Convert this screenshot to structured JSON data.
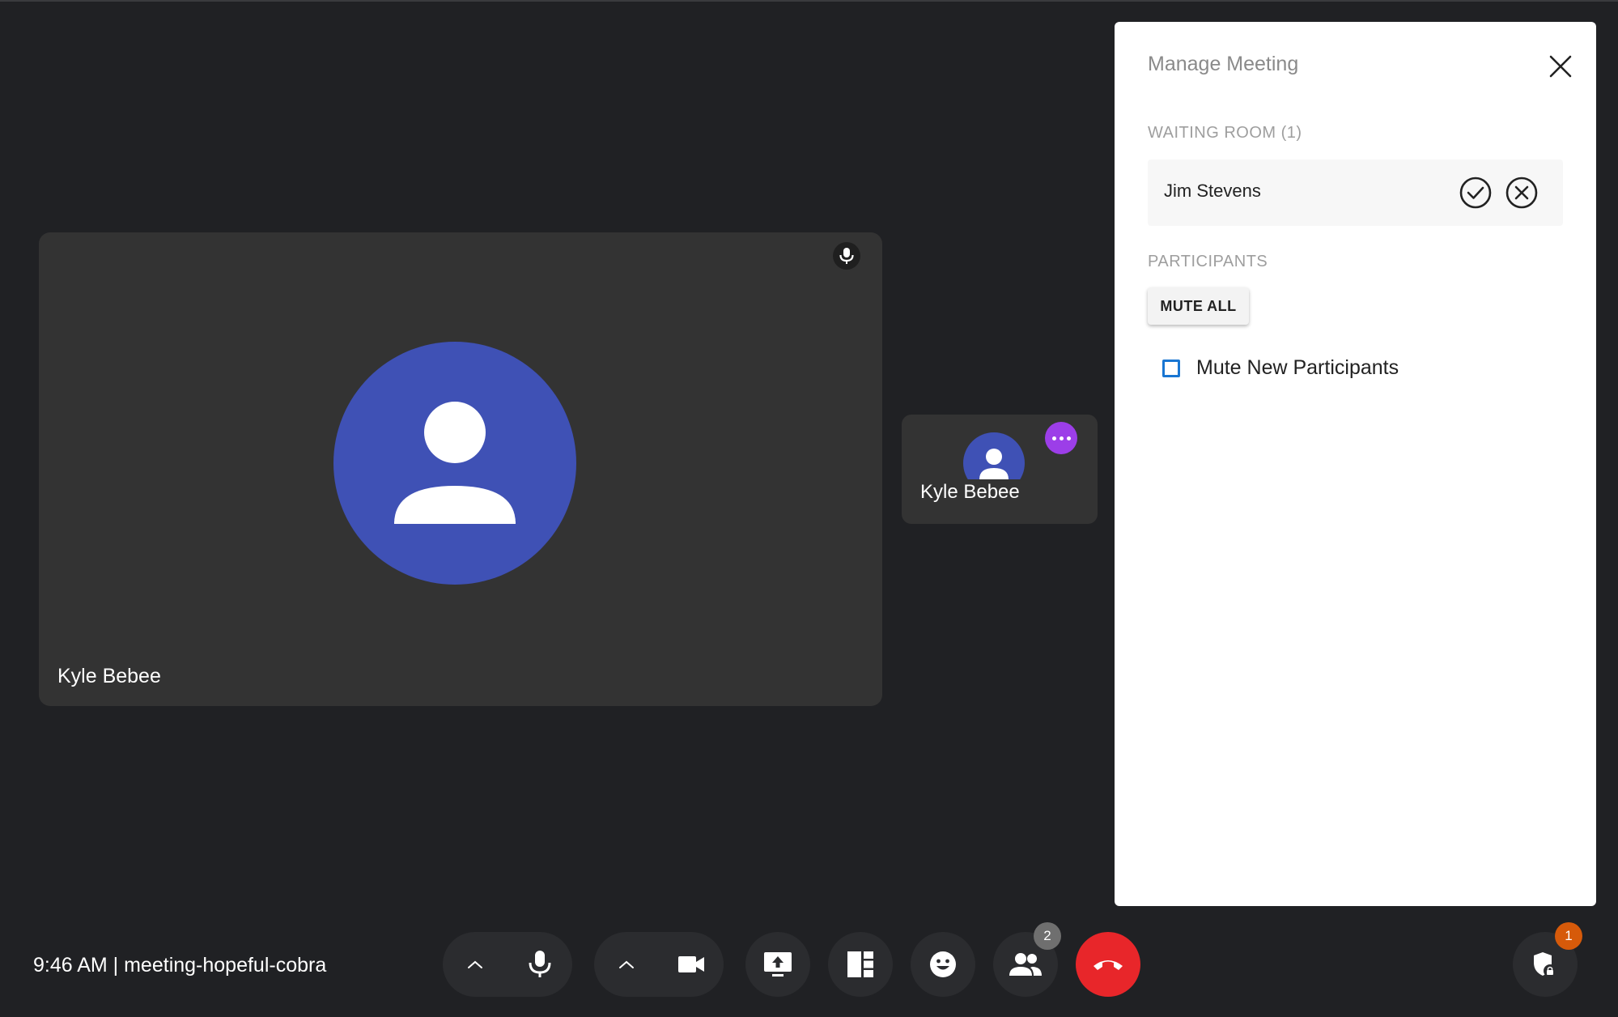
{
  "main_tile": {
    "participant_name": "Kyle Bebee",
    "mic_icon": "microphone-icon",
    "avatar_color": "#3f51b5"
  },
  "small_tile": {
    "participant_name": "Kyle Bebee",
    "menu_icon": "more-horizontal-icon",
    "menu_color": "#9c3ee8"
  },
  "manage_panel": {
    "title": "Manage Meeting",
    "close_icon": "close-icon",
    "waiting_room": {
      "label": "WAITING ROOM (1)",
      "people": [
        {
          "name": "Jim Stevens",
          "admit_icon": "check-circle-icon",
          "deny_icon": "x-circle-icon"
        }
      ]
    },
    "participants": {
      "label": "PARTICIPANTS",
      "mute_all_label": "MUTE ALL",
      "mute_new_label": "Mute New Participants",
      "mute_new_checked": false
    }
  },
  "bottom_bar": {
    "meeting_info": "9:46 AM | meeting-hopeful-cobra",
    "participants_count": "2",
    "security_badge": "1",
    "hangup_color": "#e8262a"
  }
}
